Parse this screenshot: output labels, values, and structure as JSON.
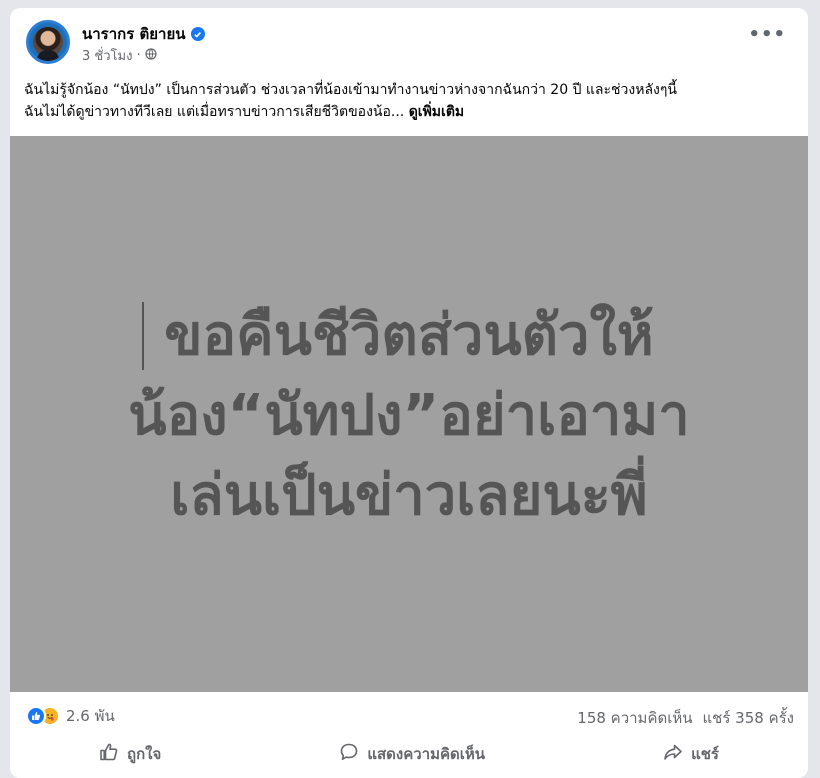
{
  "post": {
    "author": "นารากร ติยายน",
    "time": "3 ชั่วโมง",
    "time_separator": "·",
    "menu_glyph": "•••",
    "text_line1": "ฉันไม่รู้จักน้อง “นัทปง” เป็นการส่วนตัว ช่วงเวลาที่น้องเข้ามาทำงานข่าวห่างจากฉันกว่า 20 ปี  และช่วงหลังๆนี้",
    "text_line2": "ฉันไม่ได้ดูข่าวทางทีวีเลย  แต่เมื่อทราบข่าวการเสียชีวิตของน้อ...",
    "see_more": "ดูเพิ่มเติม"
  },
  "image": {
    "line1": "ขอคืนชีวิตส่วนตัวให้",
    "line2": "น้อง“นัทปง”อย่าเอามา",
    "line3": "เล่นเป็นข่าวเลยนะพี่",
    "background": "#a0a0a0",
    "text_color": "#555555"
  },
  "stats": {
    "reactions": "2.6 พัน",
    "comments": "158 ความคิดเห็น",
    "shares": "แชร์ 358 ครั้ง"
  },
  "actions": {
    "like": "ถูกใจ",
    "comment": "แสดงความคิดเห็น",
    "share": "แชร์"
  },
  "icons": {
    "verified": "verified-badge-icon",
    "globe": "globe-icon",
    "more": "more-options-icon",
    "like_reaction": "like-reaction-icon",
    "care_reaction": "care-reaction-icon",
    "like": "thumbs-up-icon",
    "comment": "comment-bubble-icon",
    "share": "share-arrow-icon"
  },
  "colors": {
    "accent": "#1877f2",
    "muted": "#65676b"
  }
}
